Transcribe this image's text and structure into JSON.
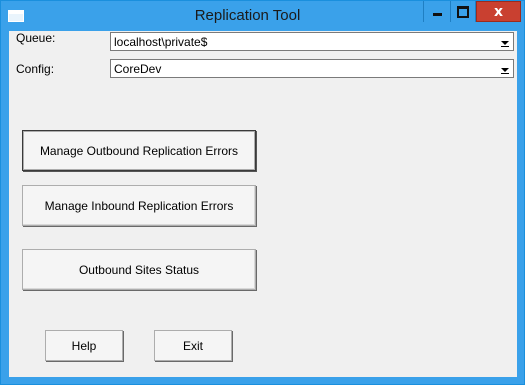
{
  "window": {
    "title": "Replication Tool",
    "close_glyph": "x"
  },
  "form": {
    "queue_label": "Queue:",
    "queue_value": "localhost\\private$",
    "config_label": "Config:",
    "config_value": "CoreDev"
  },
  "buttons": {
    "manage_outbound": "Manage Outbound Replication Errors",
    "manage_inbound": "Manage Inbound Replication Errors",
    "outbound_sites_status": "Outbound Sites Status",
    "help": "Help",
    "exit": "Exit"
  },
  "colors": {
    "title_bar": "#3aa1ea",
    "close_button": "#c94030",
    "client_background": "#f0f0f0"
  },
  "icons": {
    "app": "window-app-icon",
    "minimize": "minimize-icon",
    "maximize": "maximize-icon",
    "close": "close-icon",
    "dropdown": "chevron-down-icon"
  }
}
